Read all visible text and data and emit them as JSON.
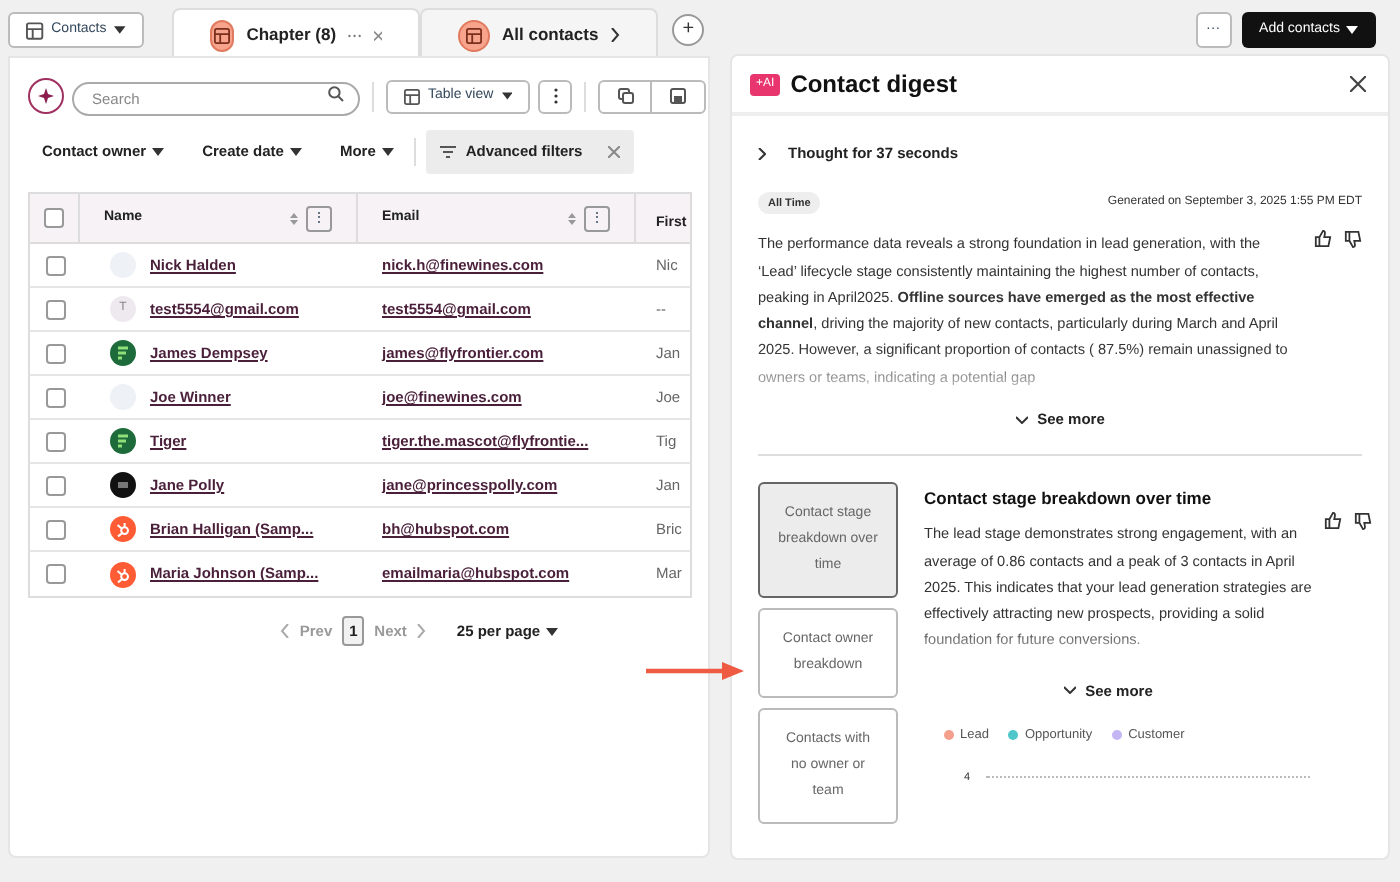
{
  "object_selector": {
    "label": "Contacts"
  },
  "tabs": [
    {
      "label": "Chapter (8)",
      "selected": true,
      "closable": true
    },
    {
      "label": "All contacts",
      "selected": false,
      "closable": false
    }
  ],
  "header_actions": {
    "more": "···",
    "add": "Add contacts"
  },
  "toolbar": {
    "search_placeholder": "Search",
    "view": "Table view"
  },
  "filters": [
    {
      "label": "Contact owner",
      "kind": "dropdown"
    },
    {
      "label": "Create date",
      "kind": "dropdown"
    },
    {
      "label": "More",
      "kind": "dropdown"
    },
    {
      "label": "Advanced filters",
      "kind": "advanced"
    }
  ],
  "add_tab": "+",
  "table": {
    "columns": [
      "Name",
      "Email",
      "First"
    ],
    "column_menu": "⋮",
    "select_all_checked": false,
    "rows": [
      {
        "kind": "blank",
        "name": "Nick Halden",
        "email": "nick.h@finewines.com",
        "first": "Nic",
        "checked": false
      },
      {
        "kind": "letter",
        "initial": "T",
        "name": "test5554@gmail.com",
        "email": "test5554@gmail.com",
        "first": "--",
        "checked": false
      },
      {
        "kind": "leaf",
        "name": "James Dempsey",
        "email": "james@flyfrontier.com",
        "first": "Jan",
        "checked": false
      },
      {
        "kind": "blank",
        "name": "Joe Winner",
        "email": "joe@finewines.com",
        "first": "Joe",
        "checked": false
      },
      {
        "kind": "leaf",
        "name": "Tiger",
        "email": "tiger.the.mascot@flyfrontie...",
        "first": "Tig",
        "checked": false
      },
      {
        "kind": "dark",
        "name": "Jane Polly",
        "email": "jane@princesspolly.com",
        "first": "Jan",
        "checked": false
      },
      {
        "kind": "sprocket",
        "name": "Brian Halligan (Samp...",
        "email": "bh@hubspot.com",
        "first": "Bric",
        "checked": false
      },
      {
        "kind": "sprocket",
        "name": "Maria Johnson (Samp...",
        "email": "emailmaria@hubspot.com",
        "first": "Mar",
        "checked": false
      }
    ]
  },
  "pagination": {
    "prev": "Prev",
    "page": "1",
    "next": "Next",
    "per_page": "25 per page"
  },
  "digest": {
    "badge": "+AI",
    "title": "Contact digest",
    "thought": "Thought for 37 seconds",
    "range": "All Time",
    "generated": "Generated on September 3, 2025 1:55 PM EDT",
    "summary": "The performance data reveals a strong foundation in lead generation, with the ‘Lead’ lifecycle stage consistently maintaining the highest number of contacts, peaking in April2025. **Offline sources have emerged as the most effective channel**, driving the majority of new contacts, particularly during March and April 2025. However, a significant proportion of contacts ( 87.5%) remain unassigned to owners or teams, indicating a potential gap",
    "see_more": "See more",
    "sections": [
      {
        "label": "Contact stage breakdown over time",
        "selected": true
      },
      {
        "label": "Contact owner breakdown",
        "selected": false
      },
      {
        "label": "Contacts with no owner or team",
        "selected": false
      }
    ],
    "section_title": "Contact stage breakdown over time",
    "section_text": "The lead stage demonstrates strong engagement, with an average of 0.86 contacts and a peak of 3 contacts in April 2025. This indicates that your lead generation strategies are effectively attracting new prospects, providing a solid foundation for future conversions.",
    "section_see_more": "See more",
    "legend": [
      {
        "label": "Lead",
        "color": "#f5a08c"
      },
      {
        "label": "Opportunity",
        "color": "#4fc6c9"
      },
      {
        "label": "Customer",
        "color": "#c4b5f5"
      }
    ],
    "y_tick": "4"
  }
}
